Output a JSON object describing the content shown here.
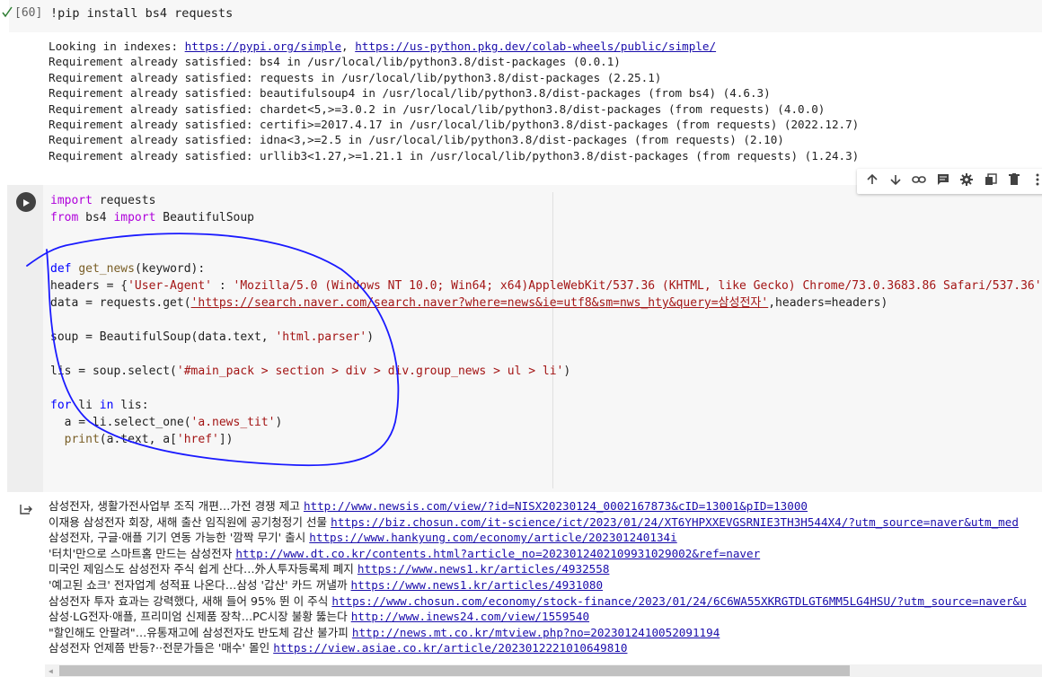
{
  "cell1": {
    "execution_count": "[60]",
    "code": "!pip install bs4 requests",
    "output": [
      {
        "text": "Looking in indexes: ",
        "links": [
          "https://pypi.org/simple",
          "https://us-python.pkg.dev/colab-wheels/public/simple/"
        ],
        "sep": ", "
      },
      {
        "text": "Requirement already satisfied: bs4 in /usr/local/lib/python3.8/dist-packages (0.0.1)"
      },
      {
        "text": "Requirement already satisfied: requests in /usr/local/lib/python3.8/dist-packages (2.25.1)"
      },
      {
        "text": "Requirement already satisfied: beautifulsoup4 in /usr/local/lib/python3.8/dist-packages (from bs4) (4.6.3)"
      },
      {
        "text": "Requirement already satisfied: chardet<5,>=3.0.2 in /usr/local/lib/python3.8/dist-packages (from requests) (4.0.0)"
      },
      {
        "text": "Requirement already satisfied: certifi>=2017.4.17 in /usr/local/lib/python3.8/dist-packages (from requests) (2022.12.7)"
      },
      {
        "text": "Requirement already satisfied: idna<3,>=2.5 in /usr/local/lib/python3.8/dist-packages (from requests) (2.10)"
      },
      {
        "text": "Requirement already satisfied: urllib3<1.27,>=1.21.1 in /usr/local/lib/python3.8/dist-packages (from requests) (1.24.3)"
      }
    ]
  },
  "toolbar": {
    "icons": [
      "arrow-up-icon",
      "arrow-down-icon",
      "link-icon",
      "comment-icon",
      "gear-icon",
      "mirror-icon",
      "trash-icon",
      "more-icon"
    ]
  },
  "cell2": {
    "code": {
      "l1_kw": "import",
      "l1_rest": " requests",
      "l2_kw": "from",
      "l2_mod": " bs4 ",
      "l2_kw2": "import",
      "l2_rest": " BeautifulSoup",
      "l5_kw": "def",
      "l5_fn": "get_news",
      "l5_rest": "(keyword):",
      "l6_a": "headers = {",
      "l6_s1": "'User-Agent'",
      "l6_b": " : ",
      "l6_s2": "'Mozilla/5.0 (Windows NT 10.0; Win64; x64)AppleWebKit/537.36 (KHTML, like Gecko) Chrome/73.0.3683.86 Safari/537.36'",
      "l6_c": "}",
      "l7_a": "data = requests.get(",
      "l7_s": "'https://search.naver.com/search.naver?where=news&ie=utf8&sm=nws_hty&query=삼성전자'",
      "l7_b": ",headers=headers)",
      "l9_a": "soup = BeautifulSoup(data.text, ",
      "l9_s": "'html.parser'",
      "l9_b": ")",
      "l11_a": "lis = soup.select(",
      "l11_s": "'#main_pack > section > div > div.group_news > ul > li'",
      "l11_b": ")",
      "l13_kw": "for",
      "l13_a": " li ",
      "l13_kw2": "in",
      "l13_b": " lis:",
      "l14_a": "  a = li.select_one(",
      "l14_s": "'a.news_tit'",
      "l14_b": ")",
      "l15_fn": "  print",
      "l15_a": "(a.text, a[",
      "l15_s": "'href'",
      "l15_b": "])"
    },
    "output": [
      {
        "text": "삼성전자, 생활가전사업부 조직 개편…가전 경쟁 제고 ",
        "url": "http://www.newsis.com/view/?id=NISX20230124_0002167873&cID=13001&pID=13000"
      },
      {
        "text": "이재용 삼성전자 회장, 새해 출산 임직원에 공기청정기 선물 ",
        "url": "https://biz.chosun.com/it-science/ict/2023/01/24/XT6YHPXXEVGSRNIE3TH3H544X4/?utm_source=naver&utm_med"
      },
      {
        "text": "삼성전자, 구글·애플 기기 연동 가능한 '깜짝 무기' 출시 ",
        "url": "https://www.hankyung.com/economy/article/202301240134i"
      },
      {
        "text": "'터치'만으로 스마트홈 만드는 삼성전자 ",
        "url": "http://www.dt.co.kr/contents.html?article_no=2023012402109931029002&ref=naver"
      },
      {
        "text": "미국인 제임스도 삼성전자 주식 쉽게 산다…外人투자등록제 폐지 ",
        "url": "https://www.news1.kr/articles/4932558"
      },
      {
        "text": "'예고된 쇼크' 전자업계 성적표 나온다…삼성 '갑산' 카드 꺼낼까 ",
        "url": "https://www.news1.kr/articles/4931080"
      },
      {
        "text": "삼성전자 투자 효과는 강력했다, 새해 들어 95% 뛴 이 주식 ",
        "url": "https://www.chosun.com/economy/stock-finance/2023/01/24/6C6WA55XKRGTDLGT6MM5LG4HSU/?utm_source=naver&u"
      },
      {
        "text": "삼성·LG전자·애플, 프리미엄 신제품 장착…PC시장 불황 뚫는다 ",
        "url": "http://www.inews24.com/view/1559540"
      },
      {
        "text": "\"할인해도 안팔려\"…유통재고에 삼성전자도 반도체 감산 불가피 ",
        "url": "http://news.mt.co.kr/mtview.php?no=2023012410052091194"
      },
      {
        "text": "삼성전자 언제쯤 반등?··전문가들은 '매수' 몰인 ",
        "url": "https://view.asiae.co.kr/article/2023012221010649810"
      }
    ]
  },
  "colors": {
    "annotation": "#1a1aff",
    "keyword": "#af00db",
    "string": "#a31515",
    "link": "#1a0dab"
  }
}
